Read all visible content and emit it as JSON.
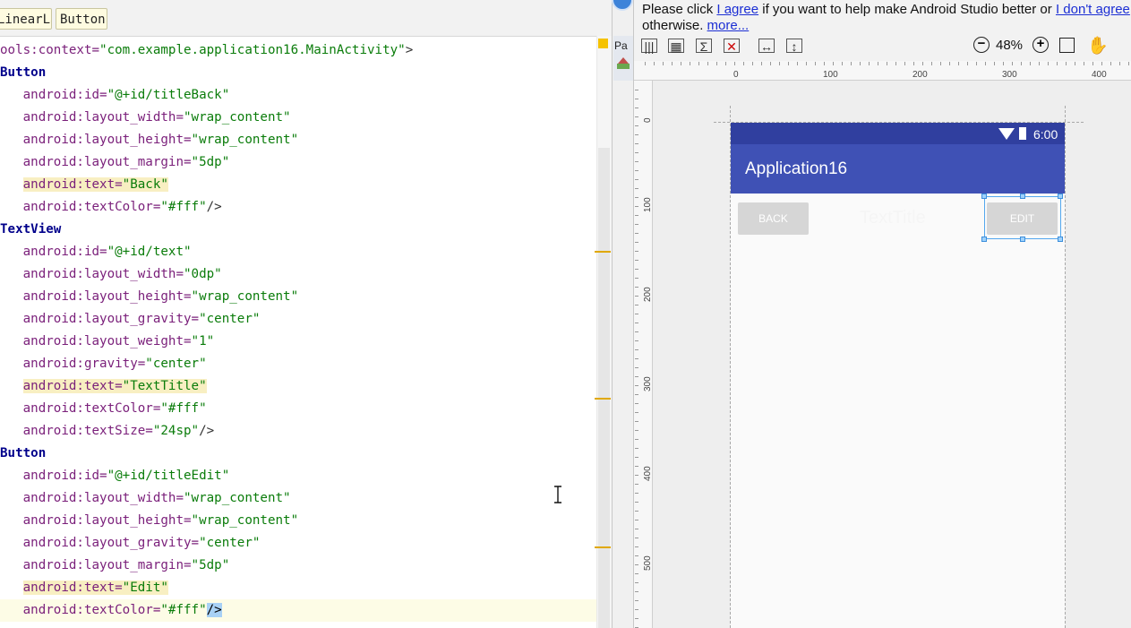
{
  "editor": {
    "breadcrumbs": [
      "LinearLayout",
      "Button"
    ],
    "lines": [
      {
        "indent": "",
        "parts": [
          {
            "t": "ools:context=",
            "c": "attr"
          },
          {
            "t": "\"com.example.application16.MainActivity\"",
            "c": "val"
          },
          {
            "t": ">",
            "c": "punc"
          }
        ]
      },
      {
        "indent": "",
        "parts": [
          {
            "t": "Button",
            "c": "tag"
          }
        ]
      },
      {
        "indent": "   ",
        "parts": [
          {
            "t": "android:id=",
            "c": "attr"
          },
          {
            "t": "\"@+id/titleBack\"",
            "c": "val"
          }
        ]
      },
      {
        "indent": "   ",
        "parts": [
          {
            "t": "android:layout_width=",
            "c": "attr"
          },
          {
            "t": "\"wrap_content\"",
            "c": "val"
          }
        ]
      },
      {
        "indent": "   ",
        "parts": [
          {
            "t": "android:layout_height=",
            "c": "attr"
          },
          {
            "t": "\"wrap_content\"",
            "c": "val"
          }
        ]
      },
      {
        "indent": "   ",
        "parts": [
          {
            "t": "android:layout_margin=",
            "c": "attr"
          },
          {
            "t": "\"5dp\"",
            "c": "val"
          }
        ]
      },
      {
        "indent": "   ",
        "hl": true,
        "parts": [
          {
            "t": "android:text=",
            "c": "attr"
          },
          {
            "t": "\"Back\"",
            "c": "val"
          }
        ]
      },
      {
        "indent": "   ",
        "parts": [
          {
            "t": "android:textColor=",
            "c": "attr"
          },
          {
            "t": "\"#fff\"",
            "c": "val"
          },
          {
            "t": "/>",
            "c": "punc"
          }
        ]
      },
      {
        "indent": "",
        "parts": [
          {
            "t": "TextView",
            "c": "tag"
          }
        ]
      },
      {
        "indent": "   ",
        "parts": [
          {
            "t": "android:id=",
            "c": "attr"
          },
          {
            "t": "\"@+id/text\"",
            "c": "val"
          }
        ]
      },
      {
        "indent": "   ",
        "parts": [
          {
            "t": "android:layout_width=",
            "c": "attr"
          },
          {
            "t": "\"0dp\"",
            "c": "val"
          }
        ]
      },
      {
        "indent": "   ",
        "parts": [
          {
            "t": "android:layout_height=",
            "c": "attr"
          },
          {
            "t": "\"wrap_content\"",
            "c": "val"
          }
        ]
      },
      {
        "indent": "   ",
        "parts": [
          {
            "t": "android:layout_gravity=",
            "c": "attr"
          },
          {
            "t": "\"center\"",
            "c": "val"
          }
        ]
      },
      {
        "indent": "   ",
        "parts": [
          {
            "t": "android:layout_weight=",
            "c": "attr"
          },
          {
            "t": "\"1\"",
            "c": "val"
          }
        ]
      },
      {
        "indent": "   ",
        "parts": [
          {
            "t": "android:gravity=",
            "c": "attr"
          },
          {
            "t": "\"center\"",
            "c": "val"
          }
        ]
      },
      {
        "indent": "   ",
        "hl": true,
        "parts": [
          {
            "t": "android:text=",
            "c": "attr"
          },
          {
            "t": "\"TextTitle\"",
            "c": "val"
          }
        ]
      },
      {
        "indent": "   ",
        "parts": [
          {
            "t": "android:textColor=",
            "c": "attr"
          },
          {
            "t": "\"#fff\"",
            "c": "val"
          }
        ]
      },
      {
        "indent": "   ",
        "parts": [
          {
            "t": "android:textSize=",
            "c": "attr"
          },
          {
            "t": "\"24sp\"",
            "c": "val"
          },
          {
            "t": "/>",
            "c": "punc"
          }
        ]
      },
      {
        "indent": "",
        "parts": [
          {
            "t": "Button",
            "c": "tag"
          }
        ]
      },
      {
        "indent": "   ",
        "parts": [
          {
            "t": "android:id=",
            "c": "attr"
          },
          {
            "t": "\"@+id/titleEdit\"",
            "c": "val"
          }
        ]
      },
      {
        "indent": "   ",
        "parts": [
          {
            "t": "android:layout_width=",
            "c": "attr"
          },
          {
            "t": "\"wrap_content\"",
            "c": "val"
          }
        ]
      },
      {
        "indent": "   ",
        "parts": [
          {
            "t": "android:layout_height=",
            "c": "attr"
          },
          {
            "t": "\"wrap_content\"",
            "c": "val"
          }
        ]
      },
      {
        "indent": "   ",
        "parts": [
          {
            "t": "android:layout_gravity=",
            "c": "attr"
          },
          {
            "t": "\"center\"",
            "c": "val"
          }
        ]
      },
      {
        "indent": "   ",
        "parts": [
          {
            "t": "android:layout_margin=",
            "c": "attr"
          },
          {
            "t": "\"5dp\"",
            "c": "val"
          }
        ]
      },
      {
        "indent": "   ",
        "hl": true,
        "parts": [
          {
            "t": "android:text=",
            "c": "attr"
          },
          {
            "t": "\"Edit\"",
            "c": "val"
          }
        ]
      },
      {
        "indent": "   ",
        "current": true,
        "parts": [
          {
            "t": "android:textColor=",
            "c": "attr"
          },
          {
            "t": "\"#fff\"",
            "c": "val"
          },
          {
            "t": "/>",
            "c": "sel"
          }
        ]
      }
    ]
  },
  "side_strip": {
    "label": "Pa"
  },
  "notification": {
    "text_before": "Please click ",
    "link_agree": "I agree",
    "text_middle": " if you want to help make Android Studio better or ",
    "link_disagree": "I don't agree",
    "text_line2": "otherwise. ",
    "link_more": "more..."
  },
  "toolbar": {
    "icons": [
      "columns-icon",
      "layout-icon",
      "sigma-icon",
      "error-icon",
      "expand-horizontal-icon",
      "expand-vertical-icon"
    ],
    "zoom_out": "−",
    "zoom_level": "48%",
    "zoom_in": "+",
    "fit_icon": "fit-screen-icon",
    "pan_icon": "✋"
  },
  "rulers": {
    "top_labels": [
      "0",
      "100",
      "200",
      "300",
      "400"
    ],
    "left_labels": [
      "0",
      "100",
      "200",
      "300",
      "400",
      "500"
    ]
  },
  "device": {
    "status_time": "6:00",
    "app_title": "Application16",
    "button_back": "BACK",
    "text_title": "TextTitle",
    "button_edit": "EDIT"
  },
  "colors": {
    "status_bar": "#303f9f",
    "app_bar": "#3f51b5",
    "selection": "#53a7ee"
  }
}
